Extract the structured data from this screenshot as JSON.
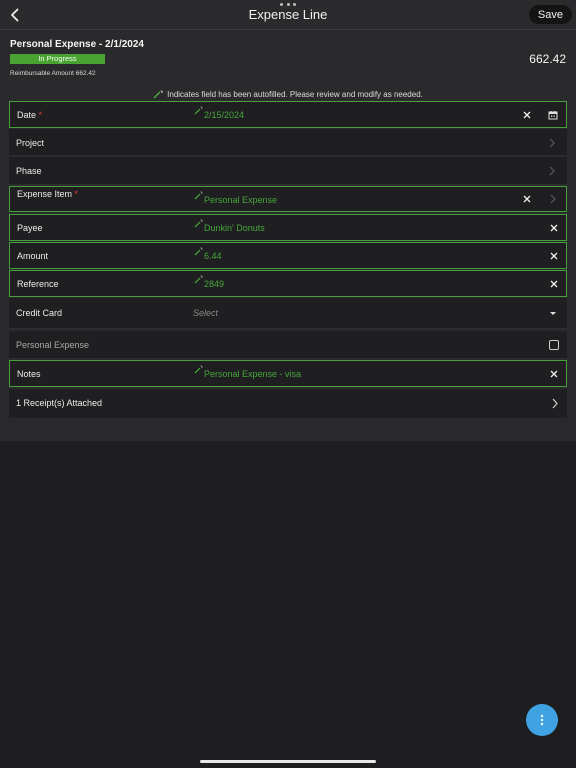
{
  "nav": {
    "title": "Expense Line",
    "save_label": "Save"
  },
  "header": {
    "title": "Personal Expense - 2/1/2024",
    "status": "In Progress",
    "reimbursable": "Reimbursable Amount 662.42",
    "total": "662.42"
  },
  "notice": "Indicates field has been autofilled. Please review and modify as needed.",
  "fields": {
    "date": {
      "label": "Date",
      "required": "*",
      "value": "2/15/2024"
    },
    "project": {
      "label": "Project"
    },
    "phase": {
      "label": "Phase"
    },
    "expense_item": {
      "label": "Expense Item",
      "required": "*",
      "value": "Personal Expense"
    },
    "payee": {
      "label": "Payee",
      "value": "Dunkin' Donuts"
    },
    "amount": {
      "label": "Amount",
      "value": "6.44"
    },
    "reference": {
      "label": "Reference",
      "value": "2849"
    },
    "credit_card": {
      "label": "Credit Card",
      "placeholder": "Select"
    },
    "personal_expense": {
      "label": "Personal Expense"
    },
    "notes": {
      "label": "Notes",
      "value": "Personal Expense - visa"
    },
    "receipts": {
      "label": "1 Receipt(s) Attached"
    }
  },
  "colors": {
    "autofill_green": "#47a53b",
    "status_green": "#4aa233",
    "fab_blue": "#3fa3e3",
    "required_red": "#e53935"
  },
  "icons": [
    "back-chevron-icon",
    "magic-wand-icon",
    "clear-x-icon",
    "calendar-icon",
    "chevron-right-icon",
    "dropdown-caret-icon",
    "more-vertical-icon"
  ]
}
